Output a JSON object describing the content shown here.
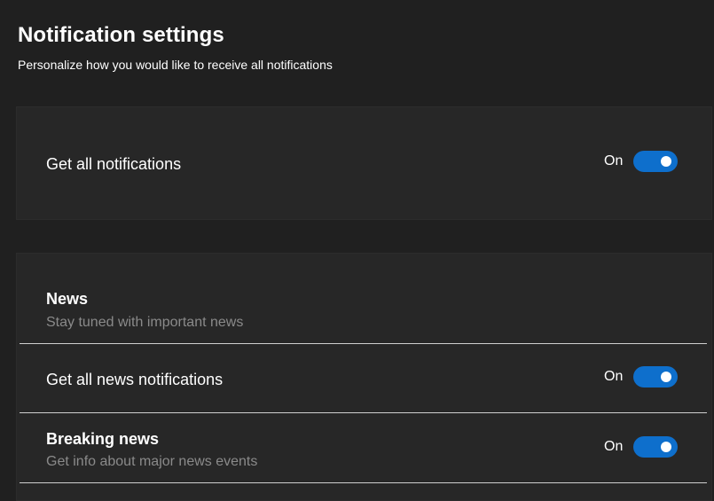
{
  "header": {
    "title": "Notification settings",
    "subtitle": "Personalize how you would like to receive all notifications"
  },
  "all_notifications": {
    "label": "Get all notifications",
    "state": "On",
    "enabled": true
  },
  "news": {
    "title": "News",
    "description": "Stay tuned with important news",
    "all_news": {
      "label": "Get all news notifications",
      "state": "On",
      "enabled": true
    },
    "breaking": {
      "title": "Breaking news",
      "description": "Get info about major news events",
      "state": "On",
      "enabled": true
    }
  },
  "colors": {
    "background": "#202020",
    "card": "#272727",
    "toggle_on": "#0e6fcc",
    "muted_text": "#8a8a8a"
  }
}
